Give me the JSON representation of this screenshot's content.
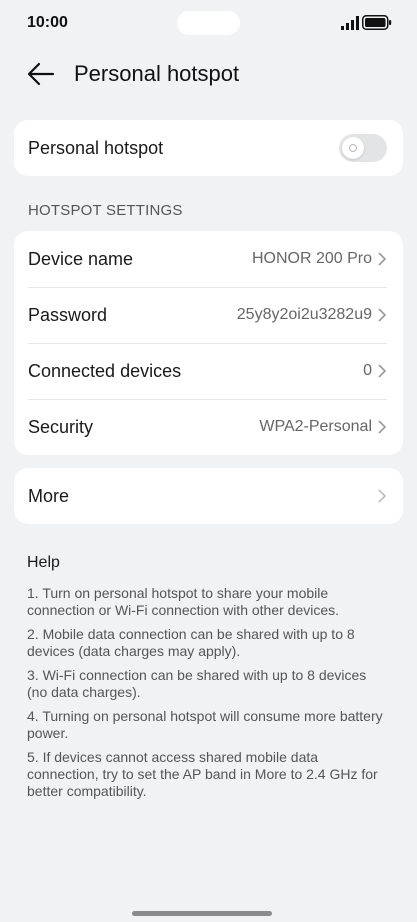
{
  "status_bar": {
    "time": "10:00"
  },
  "header": {
    "title": "Personal hotspot"
  },
  "main_toggle": {
    "label": "Personal hotspot",
    "enabled": false
  },
  "settings": {
    "section_title": "HOTSPOT SETTINGS",
    "items": [
      {
        "label": "Device name",
        "value": "HONOR 200 Pro"
      },
      {
        "label": "Password",
        "value": "25y8y2oi2u3282u9"
      },
      {
        "label": "Connected devices",
        "value": "0"
      },
      {
        "label": "Security",
        "value": "WPA2-Personal"
      }
    ]
  },
  "more": {
    "label": "More"
  },
  "help": {
    "title": "Help",
    "items": [
      "1. Turn on personal hotspot to share your mobile connection or Wi-Fi connection with other devices.",
      "2. Mobile data connection can be shared with up to 8 devices (data charges may apply).",
      "3. Wi-Fi connection can be shared with up to 8 devices (no data charges).",
      "4. Turning on personal hotspot will consume more battery power.",
      "5. If devices cannot access shared mobile data connection, try to set the AP band in More to 2.4 GHz for better compatibility."
    ]
  },
  "colors": {
    "background": "#f1f2f4",
    "card": "#ffffff",
    "toggle_off": "#e3e4e6",
    "secondary_text": "#666666"
  }
}
